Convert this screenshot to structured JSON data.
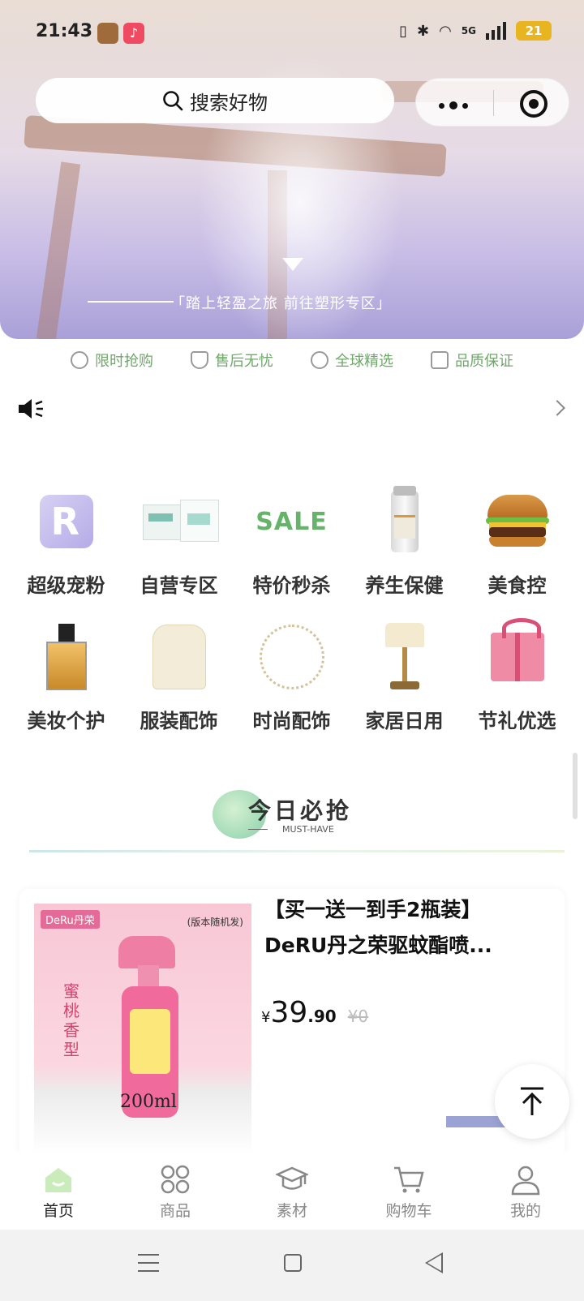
{
  "status_bar": {
    "time": "21:43",
    "network": "5G",
    "battery": "21"
  },
  "search": {
    "placeholder": "搜索好物"
  },
  "hero": {
    "caption": "「踏上轻盈之旅  前往塑形专区」"
  },
  "guarantees": [
    {
      "label": "限时抢购",
      "icon": "clock-icon"
    },
    {
      "label": "售后无忧",
      "icon": "shield-check-icon"
    },
    {
      "label": "全球精选",
      "icon": "globe-icon"
    },
    {
      "label": "品质保证",
      "icon": "quality-badge-icon"
    }
  ],
  "notice": {
    "icon": "speaker-icon"
  },
  "categories": [
    {
      "label": "超级宠粉",
      "icon": "super-fan-icon"
    },
    {
      "label": "自营专区",
      "icon": "self-operated-icon"
    },
    {
      "label": "特价秒杀",
      "icon": "sale-icon",
      "art_text": "SALE"
    },
    {
      "label": "养生保健",
      "icon": "supplement-bottle-icon"
    },
    {
      "label": "美食控",
      "icon": "burger-icon"
    },
    {
      "label": "美妆个护",
      "icon": "perfume-icon"
    },
    {
      "label": "服装配饰",
      "icon": "coat-icon"
    },
    {
      "label": "时尚配饰",
      "icon": "necklace-icon"
    },
    {
      "label": "家居日用",
      "icon": "lamp-icon"
    },
    {
      "label": "节礼优选",
      "icon": "gift-box-icon"
    }
  ],
  "section": {
    "title": "今日必抢",
    "subtitle": "MUST-HAVE"
  },
  "product": {
    "title_line1": "【买一送一到手2瓶装】",
    "title_line2": "DeRU丹之荣驱蚊酯喷...",
    "currency": "¥",
    "price_int": "39",
    "price_dec": ".90",
    "old_price": "¥0",
    "image": {
      "brand": "DeRu丹荣",
      "note": "(版本随机发)",
      "flavor": "蜜桃香型",
      "volume": "200ml"
    }
  },
  "tabbar": [
    {
      "label": "首页",
      "icon": "home-icon",
      "active": true
    },
    {
      "label": "商品",
      "icon": "grid-icon",
      "active": false
    },
    {
      "label": "素材",
      "icon": "graduation-cap-icon",
      "active": false
    },
    {
      "label": "购物车",
      "icon": "cart-icon",
      "active": false
    },
    {
      "label": "我的",
      "icon": "profile-icon",
      "active": false
    }
  ]
}
